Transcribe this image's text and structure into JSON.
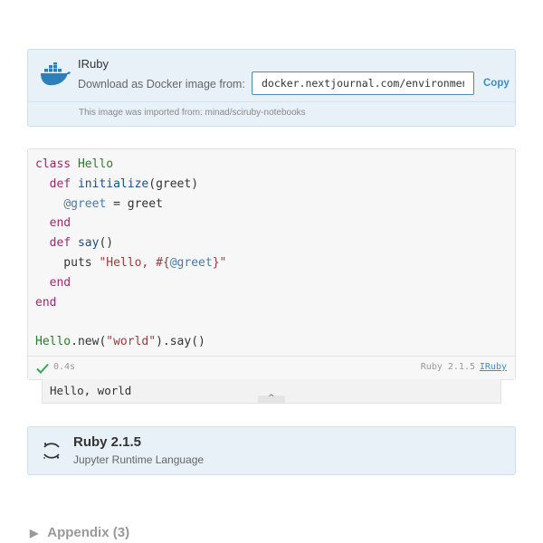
{
  "environment": {
    "title": "IRuby",
    "download_label": "Download as Docker image from:",
    "docker_url": "docker.nextjournal.com/environments/nextjournal/iruby",
    "copy_label": "Copy",
    "import_note": "This image was imported from: minad/sciruby-notebooks",
    "icon": "docker-icon"
  },
  "code_cell": {
    "lines": [
      "class Hello",
      "  def initialize(greet)",
      "    @greet = greet",
      "  end",
      "  def say()",
      "    puts \"Hello, #{@greet}\"",
      "  end",
      "end",
      "",
      "Hello.new(\"world\").say()"
    ],
    "duration": "0.4s",
    "runtime_version": "Ruby 2.1.5",
    "runtime_link": "IRuby",
    "status_icon": "check-icon"
  },
  "output": {
    "text": "Hello, world",
    "collapse_icon": "^"
  },
  "runtime_card": {
    "name": "Ruby 2.1.5",
    "subtitle": "Jupyter Runtime Language",
    "icon": "jupyter-icon"
  },
  "appendix": {
    "arrow": "▶",
    "label": "Appendix (3)"
  },
  "colors": {
    "card_background": "#e8f1f8",
    "accent": "#3d8ec7",
    "keyword": "#9c2a6d",
    "class_name": "#2d7a2d",
    "string": "#9c3b3b"
  }
}
